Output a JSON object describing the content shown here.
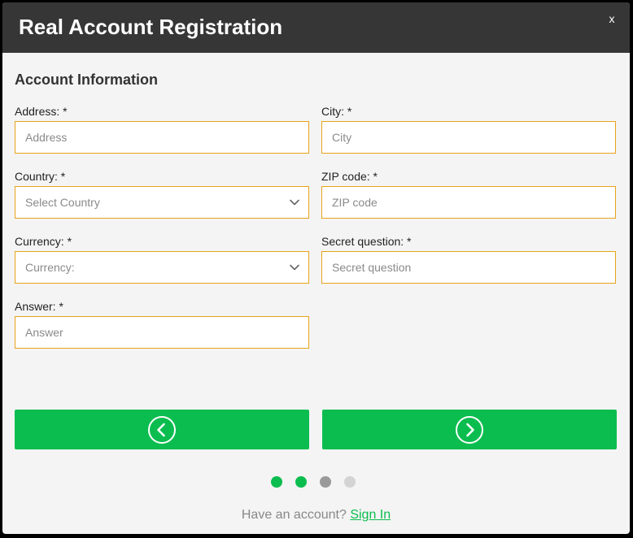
{
  "modal": {
    "title": "Real Account Registration",
    "close_label": "x"
  },
  "section": {
    "title": "Account Information"
  },
  "fields": {
    "address": {
      "label": "Address: *",
      "placeholder": "Address",
      "value": ""
    },
    "city": {
      "label": "City: *",
      "placeholder": "City",
      "value": ""
    },
    "country": {
      "label": "Country: *",
      "selected": "Select Country"
    },
    "zip": {
      "label": "ZIP code: *",
      "placeholder": "ZIP code",
      "value": ""
    },
    "currency": {
      "label": "Currency: *",
      "selected": "Currency:"
    },
    "secret_question": {
      "label": "Secret question: *",
      "placeholder": "Secret question",
      "value": ""
    },
    "answer": {
      "label": "Answer: *",
      "placeholder": "Answer",
      "value": ""
    }
  },
  "navigation": {
    "prev_icon": "chevron-left-circle-icon",
    "next_icon": "chevron-right-circle-icon"
  },
  "steps": {
    "total": 4,
    "completed": 2,
    "current": 3
  },
  "footer": {
    "prompt": "Have an account?",
    "link_label": "Sign In"
  },
  "colors": {
    "header_bg": "#363636",
    "accent_green": "#0bbd4f",
    "input_border": "#e8a31a",
    "dot_completed": "#0bbd4f",
    "dot_current": "#9a9a9a",
    "dot_pending": "#d3d3d3"
  }
}
